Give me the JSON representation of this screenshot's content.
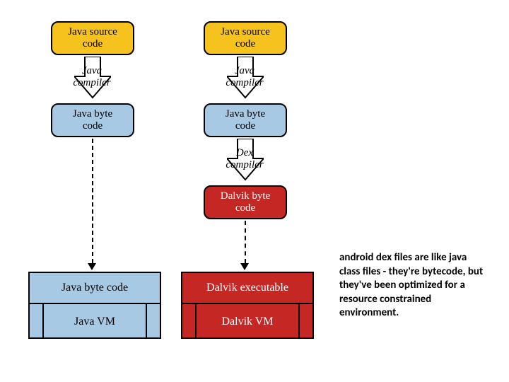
{
  "left": {
    "source": {
      "line1": "Java source",
      "line2": "code"
    },
    "compiler": {
      "line1": "Java",
      "line2": "compiler"
    },
    "bytecode": {
      "line1": "Java byte",
      "line2": "code"
    },
    "table_top": "Java byte code",
    "table_bottom": "Java VM"
  },
  "right": {
    "source": {
      "line1": "Java source",
      "line2": "code"
    },
    "compiler1": {
      "line1": "Java",
      "line2": "compiler"
    },
    "bytecode": {
      "line1": "Java byte",
      "line2": "code"
    },
    "compiler2": {
      "line1": "Dex",
      "line2": "compiler"
    },
    "dalvik_byte": {
      "line1": "Dalvik byte",
      "line2": "code"
    },
    "table_top": "Dalvik executable",
    "table_bottom": "Dalvik VM"
  },
  "annotation": "android dex files are like java class files - they're bytecode, but they've been optimized for a resource constrained environment.",
  "colors": {
    "yellow": "#f6c21e",
    "blue": "#a8c9e4",
    "red": "#c42724"
  }
}
